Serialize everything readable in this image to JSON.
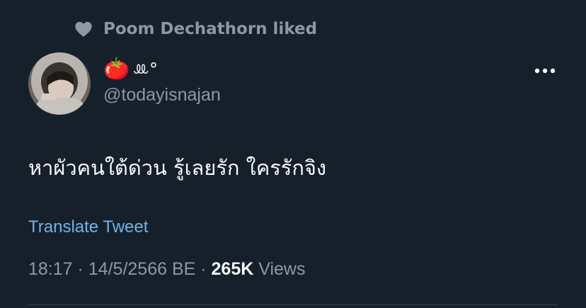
{
  "social_context": {
    "text": "Poom Dechathorn liked",
    "icon": "heart-icon"
  },
  "author": {
    "display_name_emoji": "🍅",
    "display_name_text": "ꔛ°",
    "handle": "@todayisnajan",
    "avatar": "avatar-photo"
  },
  "more_icon": "more-horizontal-icon",
  "tweet": {
    "text": "หาผัวคนใต้ด่วน รู้เลยรัก ใครรักจิง"
  },
  "translate_label": "Translate Tweet",
  "meta": {
    "time": "18:17",
    "separator1": " · ",
    "date": "14/5/2566 BE",
    "separator2": " · ",
    "views_count": "265K",
    "views_label": " Views"
  },
  "colors": {
    "background": "#15202b",
    "text_primary": "#f7f9f9",
    "text_secondary": "#8b98a5",
    "link": "#6fb2e6",
    "divider": "#38444d"
  }
}
